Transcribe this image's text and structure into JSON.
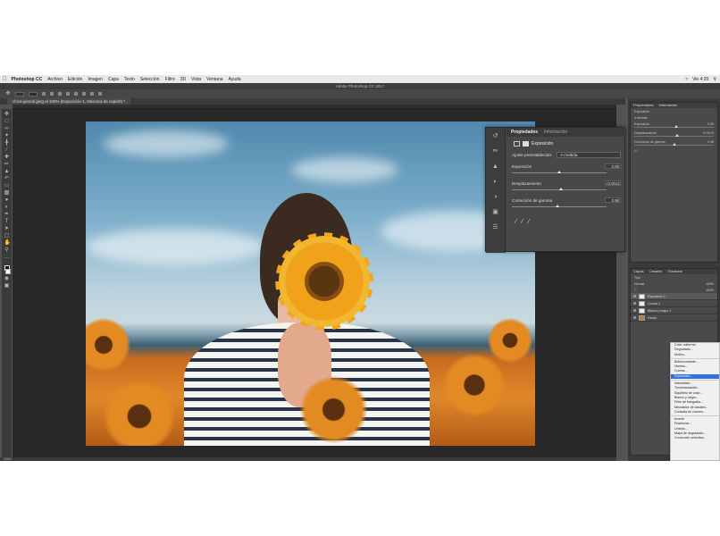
{
  "menubar": {
    "app_name": "Photoshop CC",
    "items": [
      "Archivo",
      "Edición",
      "Imagen",
      "Capa",
      "Texto",
      "Selección",
      "Filtro",
      "3D",
      "Vista",
      "Ventana",
      "Ayuda"
    ],
    "status_right": "Vie 4:20"
  },
  "window_title": "Adobe Photoshop CC 2017",
  "document_tab": "chica-girasol.jpeg al 100% (Exposición 1, Máscara de capa/8) *",
  "properties_panel": {
    "tab_active": "Propiedades",
    "tab_inactive": "Información",
    "adjustment_name": "Exposición",
    "preset_label": "Ajuste preestablecido:",
    "preset_value": "A medida",
    "rows": [
      {
        "label": "Exposición",
        "value": "0.00",
        "position": 0.5
      },
      {
        "label": "Desplazamiento",
        "value": "+0.0013",
        "position": 0.52
      },
      {
        "label": "Corrección de gamma",
        "value": "0.98",
        "position": 0.48
      }
    ]
  },
  "dock": {
    "properties_tab": "Propiedades",
    "info_tab": "Información",
    "adjustment_name": "Exposición",
    "preset_value": "A medida",
    "rows": [
      {
        "label": "Exposición",
        "value": "0.00"
      },
      {
        "label": "Desplazamiento",
        "value": "+0.0013"
      },
      {
        "label": "Corrección de gamma",
        "value": "0.98"
      }
    ],
    "layers_tabs": [
      "Capas",
      "Canales",
      "Trazados"
    ],
    "layers_kind": "Tipo",
    "blend_mode": "Normal",
    "opacity": "100%",
    "fill": "100%",
    "layers": [
      {
        "name": "Exposición 1",
        "selected": true
      },
      {
        "name": "Curvas 1",
        "selected": false
      },
      {
        "name": "Blanco y negro 1",
        "selected": false
      },
      {
        "name": "Fondo",
        "selected": false
      }
    ]
  },
  "context_menu": {
    "items": [
      "Color uniforme...",
      "Degradado...",
      "Motivo...",
      "---",
      "Brillo/contraste...",
      "Niveles...",
      "Curvas...",
      "Exposición...",
      "---",
      "Intensidad...",
      "Tono/saturación...",
      "Equilibrio de color...",
      "Blanco y negro...",
      "Filtro de fotografía...",
      "Mezclador de canales...",
      "Consulta de colores...",
      "---",
      "Invertir",
      "Posterizar...",
      "Umbral...",
      "Mapa de degradado...",
      "Corrección selectiva..."
    ],
    "highlighted": "Exposición..."
  },
  "statusbar": {
    "zoom": "100%"
  },
  "colors": {
    "accent": "#2f6fe0",
    "panel": "#484848",
    "canvas_bg": "#282828"
  },
  "icons": {
    "eyedropper": "eyedropper-icon",
    "layer_eye": "eye-icon"
  }
}
